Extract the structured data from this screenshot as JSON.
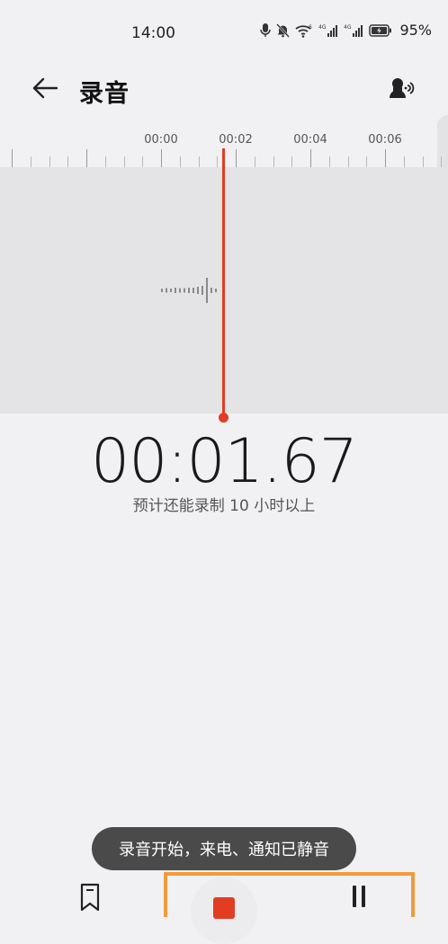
{
  "status_bar": {
    "time": "14:00",
    "battery_percent": "95%",
    "icons": [
      "microphone-icon",
      "bell-muted-icon",
      "wifi-6-icon",
      "signal-4g-icon",
      "signal-4g-icon",
      "battery-charging-icon"
    ]
  },
  "header": {
    "back_icon": "arrow-left-icon",
    "title": "录音",
    "voice_icon": "voice-speaker-icon"
  },
  "timeline": {
    "labels": [
      "00:00",
      "00:02",
      "00:04",
      "00:06"
    ]
  },
  "recording": {
    "elapsed": "00:01.67",
    "remaining_text": "预计还能录制 10 小时以上"
  },
  "toast": {
    "message": "录音开始，来电、通知已静音"
  },
  "controls": {
    "bookmark_icon": "bookmark-icon",
    "stop_icon": "stop-icon",
    "pause_icon": "pause-icon",
    "accent_color": "#e23c23",
    "highlight_color": "#f39a3c"
  }
}
